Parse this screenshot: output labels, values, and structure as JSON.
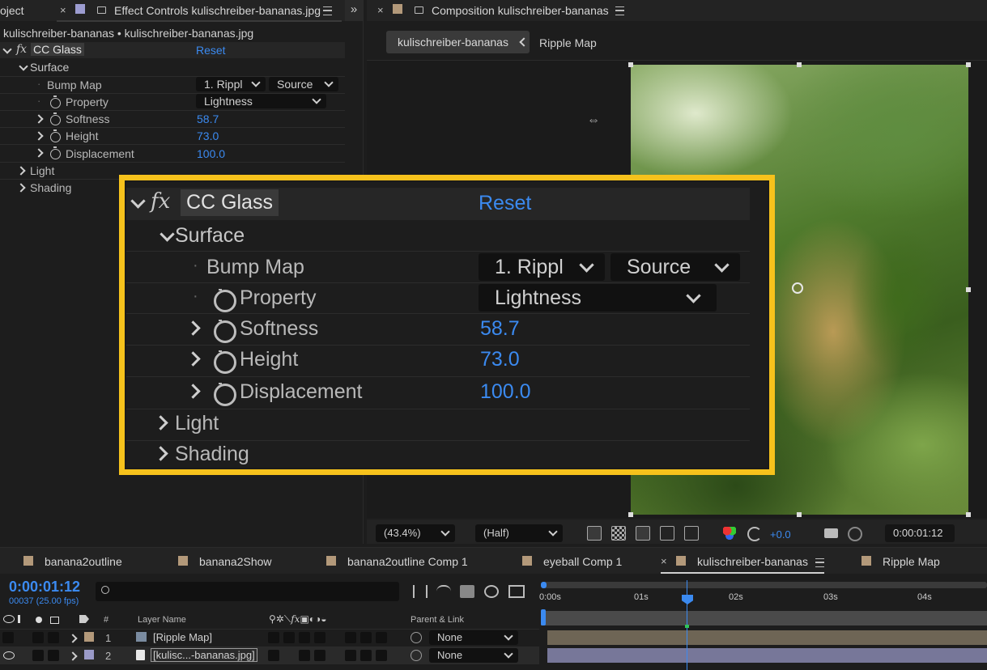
{
  "colors": {
    "accent_blue": "#3b8af0",
    "highlight_yellow": "#f6c21c",
    "swatch_tan": "#b3997a",
    "swatch_lavender": "#9a9ac8"
  },
  "left_panel": {
    "tab_project_partial": "oject",
    "tab_close": "×",
    "tab_title": "Effect Controls kulischreiber-bananas.jpg",
    "menu_icon": "hamburger-icon",
    "breadcrumb": "kulischreiber-bananas • kulischreiber-bananas.jpg",
    "effect_name": "CC Glass",
    "reset": "Reset",
    "surface": "Surface",
    "bump_map": "Bump Map",
    "bump_map_value": "1. Rippl",
    "bump_map_source": "Source",
    "property": "Property",
    "property_value": "Lightness",
    "softness": "Softness",
    "softness_value": "58.7",
    "height": "Height",
    "height_value": "73.0",
    "displacement": "Displacement",
    "displacement_value": "100.0",
    "light": "Light",
    "shading": "Shading"
  },
  "comp_panel": {
    "tab_close": "×",
    "tab_title": "Composition kulischreiber-bananas",
    "crumb_active": "kulischreiber-bananas",
    "crumb_next": "Ripple Map",
    "zoom": "(43.4%)",
    "resolution": "(Half)",
    "exposure": "+0.0",
    "timecode": "0:00:01:12"
  },
  "timeline": {
    "tabs": [
      {
        "label": "banana2outline"
      },
      {
        "label": "banana2Show"
      },
      {
        "label": "banana2outline Comp 1"
      },
      {
        "label": "eyeball Comp 1"
      },
      {
        "label": "kulischreiber-bananas",
        "active": true
      },
      {
        "label": "Ripple Map"
      }
    ],
    "timecode": "0:00:01:12",
    "frames": "00037 (25.00 fps)",
    "search_placeholder": "",
    "col_hash": "#",
    "col_layer_name": "Layer Name",
    "col_parent": "Parent & Link",
    "ruler": [
      "0:00s",
      "01s",
      "02s",
      "03s",
      "04s"
    ],
    "playhead_fraction": 0.7,
    "layers": [
      {
        "num": "1",
        "name": "[Ripple Map]",
        "parent": "None"
      },
      {
        "num": "2",
        "name": "[kulisc...-bananas.jpg]",
        "parent": "None"
      }
    ]
  }
}
